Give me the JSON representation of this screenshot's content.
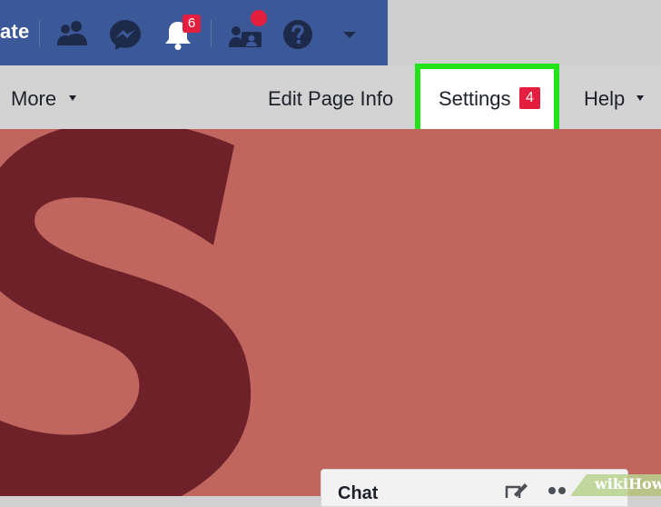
{
  "topbar": {
    "create_label": "ate",
    "notifications_badge": "6",
    "colors": {
      "bar": "#3b5998",
      "badge": "#e41e3f"
    },
    "icons": [
      "friends-icon",
      "messenger-icon",
      "notifications-icon",
      "page-admin-icon",
      "help-icon",
      "dropdown-caret-icon"
    ]
  },
  "subnav": {
    "more_label": "More",
    "edit_page_info_label": "Edit Page Info",
    "settings_label": "Settings",
    "settings_badge": "4",
    "help_label": "Help",
    "highlight_color": "#22e319"
  },
  "cover": {
    "background_color": "#c1655f",
    "letter_color": "#6e2128"
  },
  "chat": {
    "label": "Chat"
  },
  "watermark": {
    "text": "wikiHow"
  }
}
